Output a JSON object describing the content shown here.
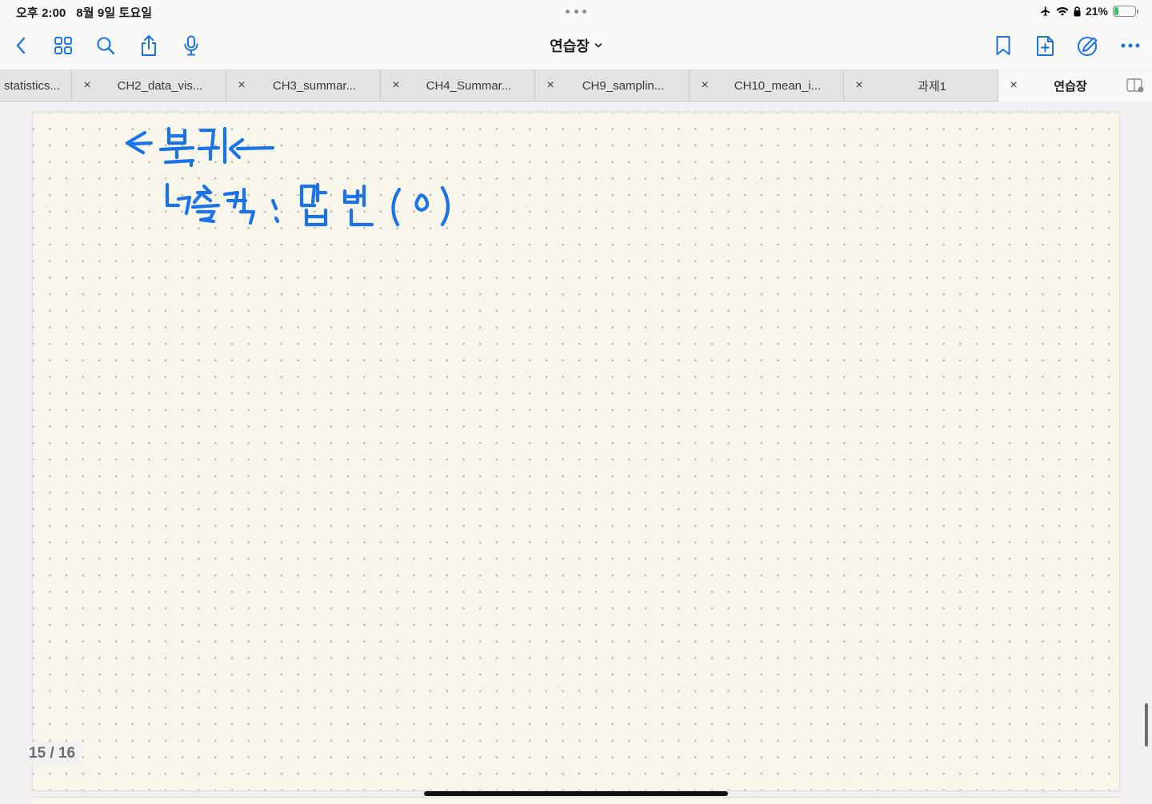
{
  "status_bar": {
    "time": "오후 2:00   8월 9일 토요일",
    "battery_percent": "21%",
    "battery_level": 0.21
  },
  "toolbar": {
    "title": "연습장",
    "icons": [
      "back-chevron-icon",
      "grid-icon",
      "search-icon",
      "share-icon",
      "microphone-icon",
      "bookmark-icon",
      "add-page-icon",
      "pencil-circle-icon",
      "more-icon"
    ]
  },
  "tabs": [
    {
      "label": "statistics...",
      "active": false
    },
    {
      "label": "CH2_data_vis...",
      "active": false
    },
    {
      "label": "CH3_summar...",
      "active": false
    },
    {
      "label": "CH4_Summar...",
      "active": false
    },
    {
      "label": "CH9_samplin...",
      "active": false
    },
    {
      "label": "CH10_mean_i...",
      "active": false
    },
    {
      "label": "과제1",
      "active": false
    },
    {
      "label": "연습장",
      "active": true
    }
  ],
  "tab_close_glyph": "×",
  "page": {
    "indicator": "15 / 16",
    "handwriting_lines": [
      "<- 복귀 <—",
      "↳ 출력 : 답변 (0)"
    ],
    "ink_color": "#1a73e8"
  }
}
